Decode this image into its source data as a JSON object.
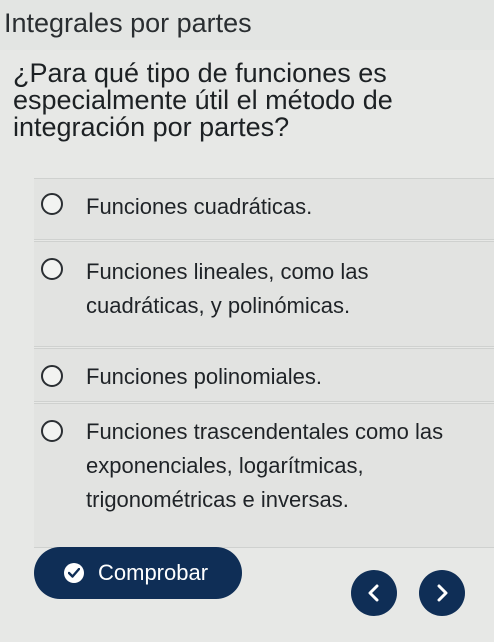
{
  "header": {
    "title": "Integrales por partes"
  },
  "question": {
    "text": "¿Para qué tipo de funciones es especialmente útil el método de integración por partes?"
  },
  "options": [
    {
      "label": "Funciones cuadráticas."
    },
    {
      "label": "Funciones lineales, como las cuadráticas,  y polinómicas."
    },
    {
      "label": "Funciones polinomiales."
    },
    {
      "label": "Funciones trascendentales como las exponenciales, logarítmicas, trigonométricas e inversas."
    }
  ],
  "actions": {
    "check_label": "Comprobar",
    "check_icon": "check-circle-icon",
    "prev_icon": "chevron-left-icon",
    "next_icon": "chevron-right-icon"
  },
  "colors": {
    "primary": "#0f2e56",
    "background": "#e7e8e6",
    "option_background": "#e2e3e1"
  }
}
